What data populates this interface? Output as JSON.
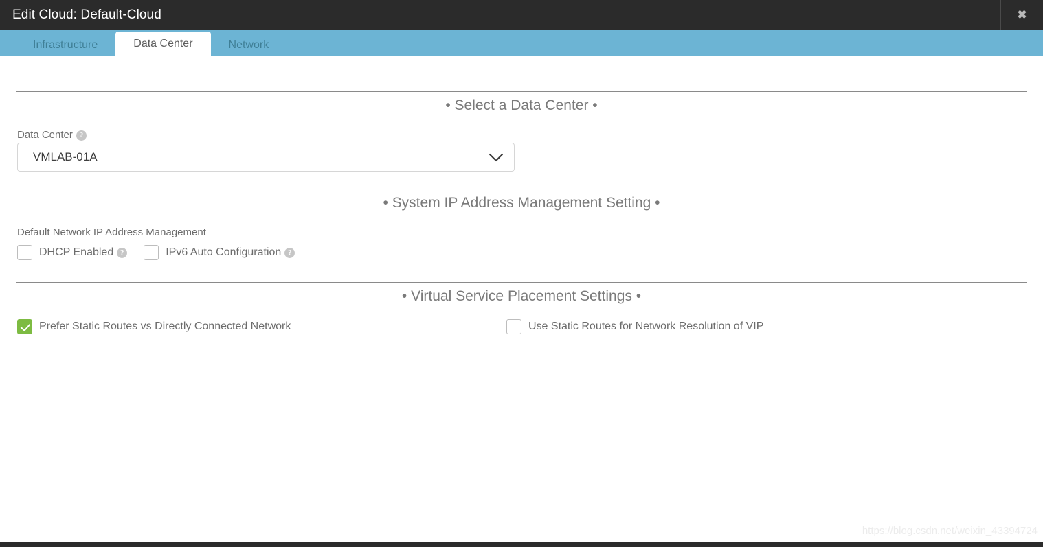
{
  "window": {
    "title": "Edit Cloud: Default-Cloud",
    "close_icon": "close-icon",
    "close_glyph": "✖"
  },
  "tabs": [
    {
      "label": "Infrastructure",
      "active": false
    },
    {
      "label": "Data Center",
      "active": true
    },
    {
      "label": "Network",
      "active": false
    }
  ],
  "sections": {
    "data_center": {
      "title": "• Select a Data Center •",
      "field_label": "Data Center",
      "help_glyph": "?",
      "selected_value": "VMLAB-01A",
      "chevron_icon": "chevron-down-icon"
    },
    "ip_management": {
      "title": "• System IP Address Management Setting •",
      "group_label": "Default Network IP Address Management",
      "checkboxes": [
        {
          "label": "DHCP Enabled",
          "checked": false,
          "help": true
        },
        {
          "label": "IPv6 Auto Configuration",
          "checked": false,
          "help": true
        }
      ]
    },
    "placement": {
      "title": "• Virtual Service Placement Settings •",
      "checkbox_left": {
        "label": "Prefer Static Routes vs Directly Connected Network",
        "checked": true
      },
      "checkbox_right": {
        "label": "Use Static Routes for Network Resolution of VIP",
        "checked": false
      }
    }
  },
  "watermark": "https://blog.csdn.net/weixin_43394724",
  "colors": {
    "titlebar": "#2b2b2b",
    "tabbar": "#6cb4d4",
    "accent_green": "#7dbb42",
    "rule": "#8a8a8a",
    "text": "#6c6c6c"
  }
}
